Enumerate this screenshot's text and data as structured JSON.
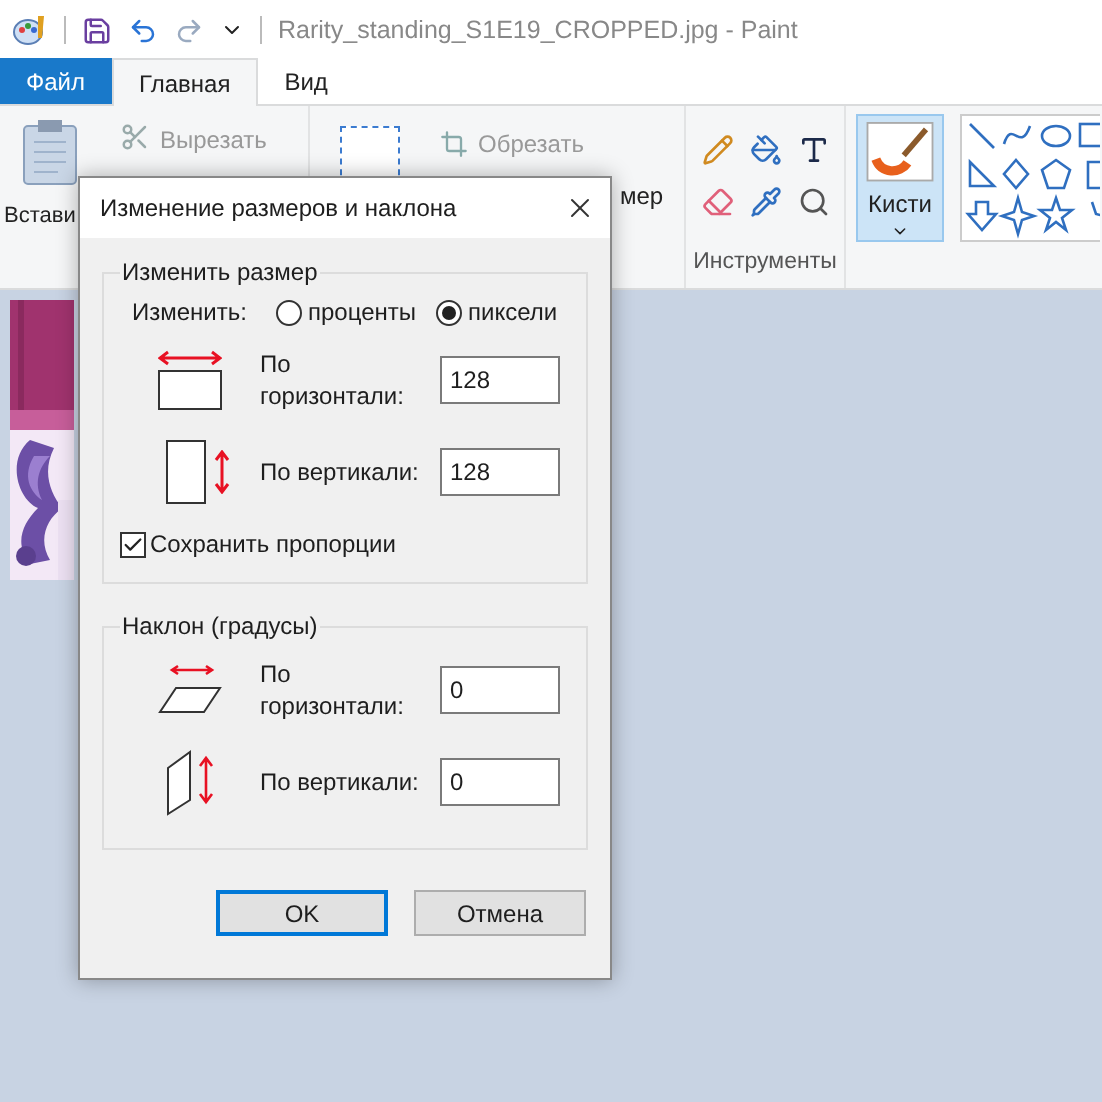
{
  "window": {
    "title": "Rarity_standing_S1E19_CROPPED.jpg - Paint"
  },
  "tabs": [
    {
      "label": "Файл",
      "kind": "file",
      "selected": false
    },
    {
      "label": "Главная",
      "kind": "tab",
      "selected": true
    },
    {
      "label": "Вид",
      "kind": "tab",
      "selected": false
    }
  ],
  "ribbon": {
    "paste_label": "Встави",
    "cut_label": "Вырезать",
    "crop_label": "Обрезать",
    "resize_label": "мер",
    "tools_group_label": "Инструменты",
    "brushes": {
      "label": "Кисти",
      "selected": true
    }
  },
  "dialog": {
    "title": "Изменение размеров и наклона",
    "resize": {
      "heading": "Изменить размер",
      "by_label": "Изменить:",
      "units": [
        {
          "label": "проценты",
          "selected": false
        },
        {
          "label": "пиксели",
          "selected": true
        }
      ],
      "horizontal": {
        "label": "По горизонтали:",
        "value": "128"
      },
      "vertical": {
        "label": "По вертикали:",
        "value": "128"
      },
      "keep_ratio": {
        "label": "Сохранить пропорции",
        "checked": true
      }
    },
    "skew": {
      "heading": "Наклон (градусы)",
      "horizontal": {
        "label": "По горизонтали:",
        "value": "0"
      },
      "vertical": {
        "label": "По вертикали:",
        "value": "0"
      }
    },
    "buttons": [
      {
        "label": "OK",
        "default": true
      },
      {
        "label": "Отмена",
        "default": false
      }
    ]
  }
}
